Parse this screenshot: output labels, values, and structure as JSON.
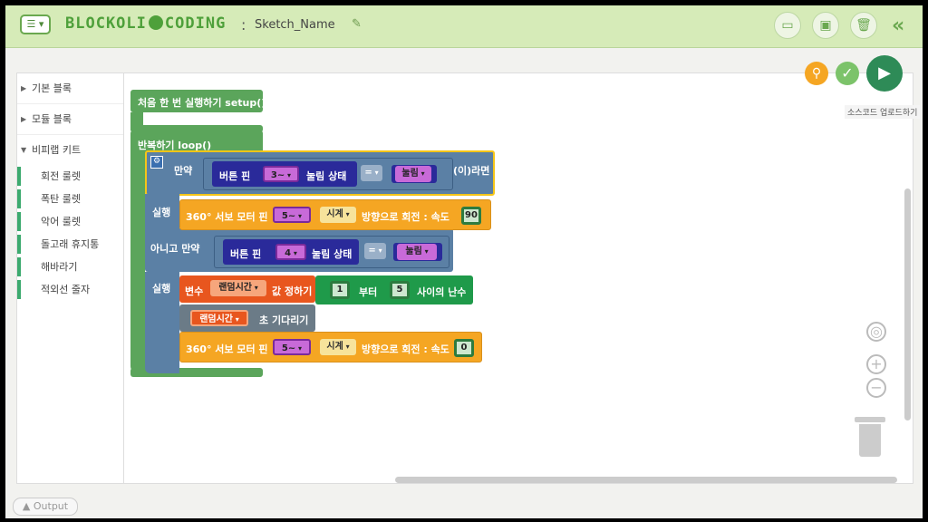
{
  "header": {
    "menu_icon": "list-icon",
    "logo_left": "BLOCKOLI",
    "logo_right": "CODING",
    "separator": ":",
    "sketch_name": "Sketch_Name",
    "icons": [
      "folder-open-icon",
      "save-icon",
      "trash-icon",
      "double-chevron-left-icon"
    ]
  },
  "toolbar": {
    "tooltip": "소스코드 업로드하기",
    "icons": [
      "zoom-icon",
      "verify-check-icon",
      "upload-play-icon"
    ]
  },
  "sidebar": {
    "categories": [
      "기본 블록",
      "모듈 블록",
      "비피랩 키트"
    ],
    "kit_items": [
      "회전 룰렛",
      "폭탄 룰렛",
      "악어 룰렛",
      "돌고래 휴지통",
      "해바라기",
      "적외선 줄자"
    ]
  },
  "blocks": {
    "setup": "처음 한 번 실행하기 setup()",
    "loop": "반복하기 loop()",
    "if_label": "만약",
    "then_label": "(이)라면",
    "do_label": "실행",
    "elseif_label": "아니고 만약",
    "button_pin": "버튼 핀",
    "press_state": "눌림 상태",
    "pin_3": "3~",
    "pin_4": "4",
    "pin_5": "5~",
    "eq": "=",
    "pressed": "눌림",
    "servo_label": "360° 서보 모터 핀",
    "clockwise": "시계",
    "direction_speed": "방향으로 회전 : 속도",
    "speed_90": "90",
    "speed_0": "0",
    "var_label": "변수",
    "var_name": "랜덤시간",
    "set_value": "값 정하기",
    "num_1": "1",
    "from": "부터",
    "num_5": "5",
    "random_between": "사이의 난수",
    "wait_seconds": "초 기다리기"
  },
  "footer": {
    "output": "Output"
  },
  "colors": {
    "header_bg": "#d6ebb8",
    "brand_green": "#4ea03a",
    "loop_green": "#5ba55b",
    "if_blue": "#5b80a5",
    "button_navy": "#2a2a9a",
    "servo_orange": "#f5a623",
    "var_orange": "#e8561e",
    "math_green": "#1f9a4a",
    "wait_gray": "#6b7b87"
  }
}
